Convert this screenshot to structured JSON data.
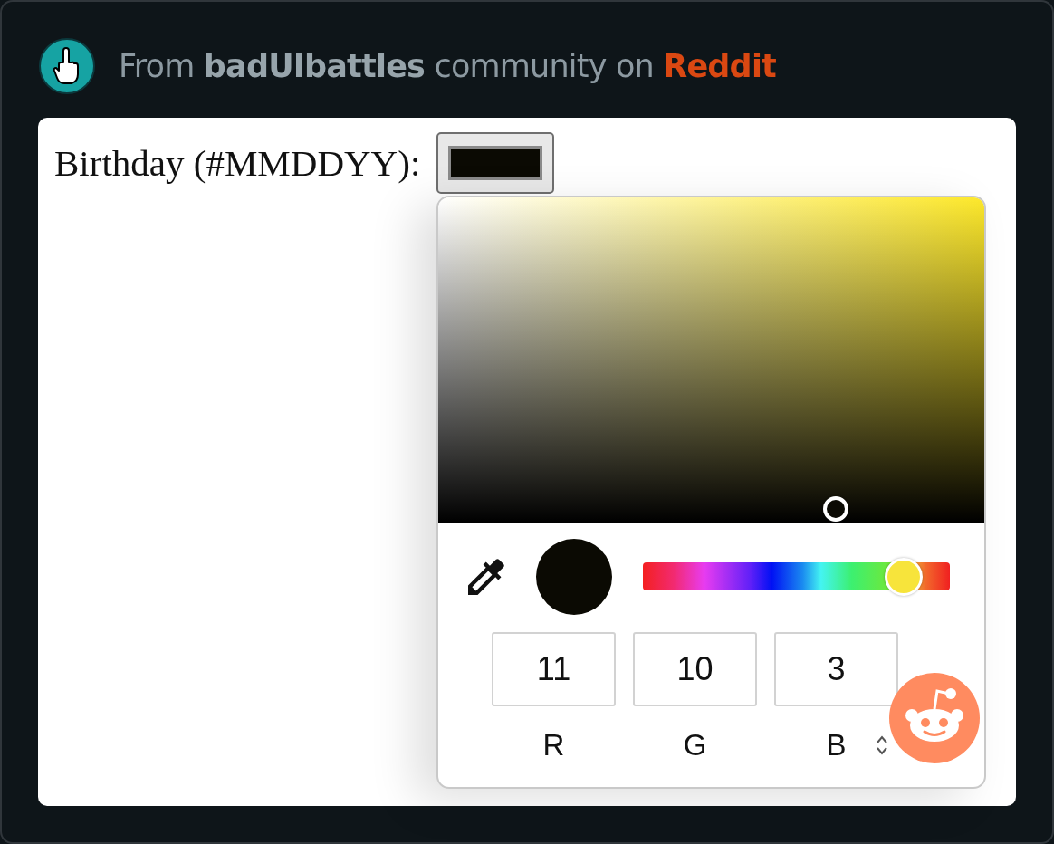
{
  "attribution": {
    "text": "From **badUIbattles** community on",
    "link": "Reddit"
  },
  "form": {
    "label": "Birthday (#MMDDYY):",
    "color": "#0b0a03"
  },
  "picker": {
    "color": "#0b0a03",
    "hue_slider": {
      "level": 0.85
    },
    "channels": [
      {
        "label": "R",
        "value": "11"
      },
      {
        "label": "G",
        "value": "10"
      },
      {
        "label": "B",
        "value": "3"
      }
    ]
  }
}
